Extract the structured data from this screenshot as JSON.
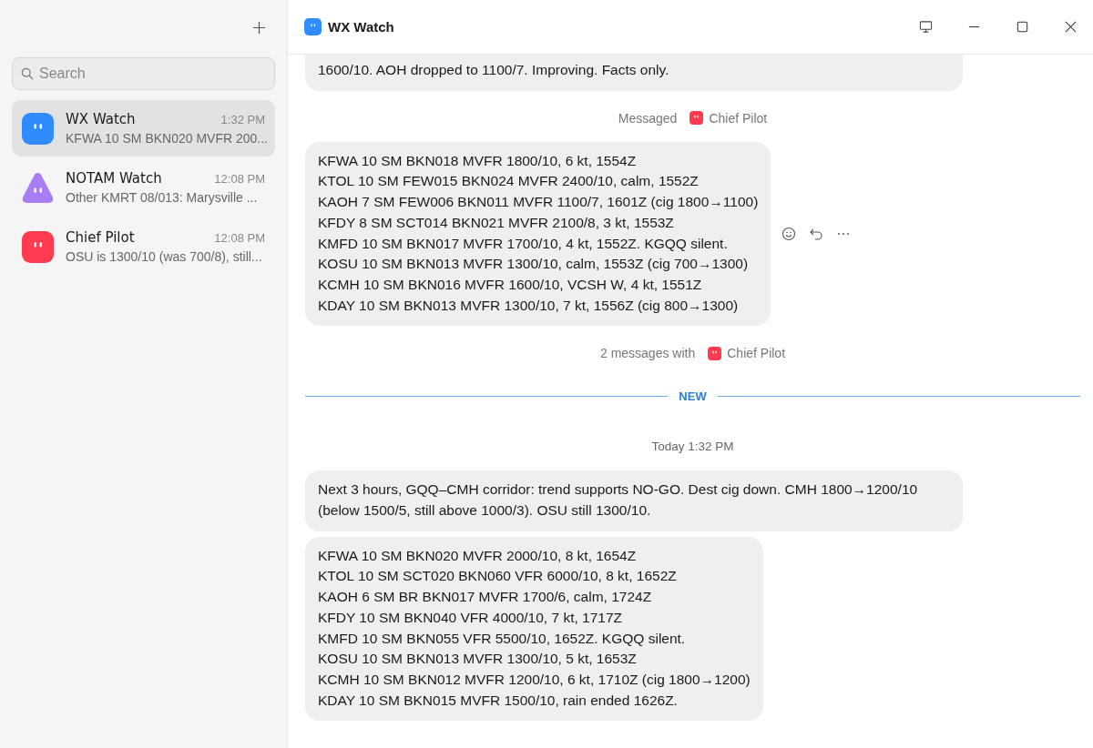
{
  "window": {
    "title": "WX Watch"
  },
  "sidebar": {
    "search": {
      "placeholder": "Search"
    },
    "chats": [
      {
        "name": "WX Watch",
        "time": "1:32 PM",
        "preview": "KFWA 10 SM BKN020 MVFR 200...",
        "color": "#2f8cff",
        "kind": "square",
        "selected": true
      },
      {
        "name": "NOTAM Watch",
        "time": "12:08 PM",
        "preview": "Other KMRT 08/013: Marysville ...",
        "color": "#a97ef5",
        "kind": "triangle",
        "selected": false
      },
      {
        "name": "Chief Pilot",
        "time": "12:08 PM",
        "preview": "OSU is 1300/10 (was 700/8), still...",
        "color": "#ff3b50",
        "kind": "square",
        "selected": false
      }
    ]
  },
  "messages": [
    {
      "kind": "bubble",
      "cut": true,
      "lines": [
        "1600/10. AOH dropped to 1100/7. Improving. Facts only."
      ]
    },
    {
      "kind": "event",
      "text": "Messaged",
      "who": "Chief Pilot",
      "color": "#ff3b50"
    },
    {
      "kind": "bubble",
      "actions": true,
      "lines": [
        "KFWA 10 SM BKN018 MVFR 1800/10, 6 kt, 1554Z",
        "KTOL 10 SM FEW015 BKN024 MVFR 2400/10, calm, 1552Z",
        "KAOH 7 SM FEW006 BKN011 MVFR 1100/7, 1601Z (cig 1800→1100)",
        "KFDY 8 SM SCT014 BKN021 MVFR 2100/8, 3 kt, 1553Z",
        "KMFD 10 SM BKN017 MVFR 1700/10, 4 kt, 1552Z. KGQQ silent.",
        "KOSU 10 SM BKN013 MVFR 1300/10, calm, 1553Z (cig 700→1300)",
        "KCMH 10 SM BKN016 MVFR 1600/10, VCSH W, 4 kt, 1551Z",
        "KDAY 10 SM BKN013 MVFR 1300/10, 7 kt, 1556Z (cig 800→1300)"
      ]
    },
    {
      "kind": "event",
      "text": "2 messages with",
      "who": "Chief Pilot",
      "color": "#ff3b50"
    },
    {
      "kind": "divider",
      "text": "NEW"
    },
    {
      "kind": "timestamp",
      "text": "Today 1:32 PM"
    },
    {
      "kind": "bubble",
      "lines": [
        "Next 3 hours, GQQ–CMH corridor: trend supports NO-GO. Dest cig down. CMH 1800→1200/10 (below 1500/5, still above 1000/3). OSU still 1300/10."
      ]
    },
    {
      "kind": "bubble",
      "lines": [
        "KFWA 10 SM BKN020 MVFR 2000/10, 8 kt, 1654Z",
        "KTOL 10 SM SCT020 BKN060 VFR 6000/10, 8 kt, 1652Z",
        "KAOH 6 SM BR BKN017 MVFR 1700/6, calm, 1724Z",
        "KFDY 10 SM BKN040 VFR 4000/10, 7 kt, 1717Z",
        "KMFD 10 SM BKN055 VFR 5500/10, 1652Z. KGQQ silent.",
        "KOSU 10 SM BKN013 MVFR 1300/10, 5 kt, 1653Z",
        "KCMH 10 SM BKN012 MVFR 1200/10, 6 kt, 1710Z (cig 1800→1200)",
        "KDAY 10 SM BKN015 MVFR 1500/10, rain ended 1626Z."
      ]
    }
  ]
}
